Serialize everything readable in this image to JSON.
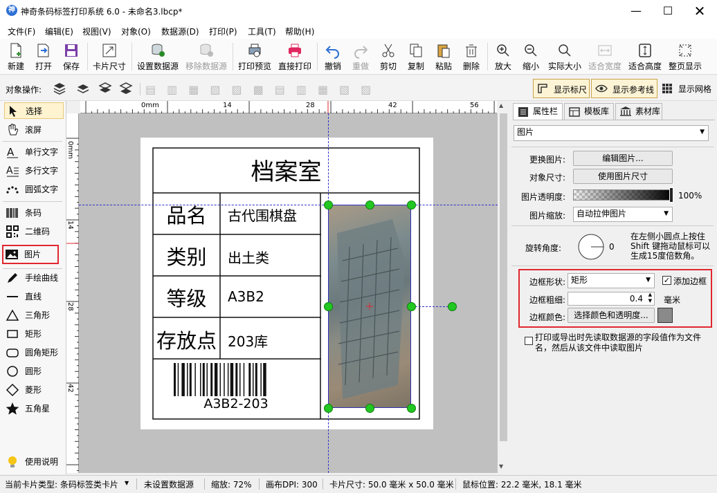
{
  "window": {
    "title": "神奇条码标签打印系统 6.0 - 未命名3.lbcp*"
  },
  "menu": [
    "文件(F)",
    "编辑(E)",
    "视图(V)",
    "对象(O)",
    "数据源(D)",
    "打印(P)",
    "工具(T)",
    "帮助(H)"
  ],
  "toolbar": {
    "new": "新建",
    "open": "打开",
    "save": "保存",
    "card_size": "卡片尺寸",
    "set_datasource": "设置数据源",
    "remove_datasource": "移除数据源",
    "print_preview": "打印预览",
    "direct_print": "直接打印",
    "undo": "撤销",
    "redo": "重做",
    "cut": "剪切",
    "copy": "复制",
    "paste": "粘贴",
    "delete": "删除",
    "zoom_in": "放大",
    "zoom_out": "缩小",
    "actual_size": "实际大小",
    "fit_width": "适合宽度",
    "fit_height": "适合高度",
    "full_page": "整页显示"
  },
  "objbar": {
    "label": "对象操作:",
    "show_ruler": "显示标尺",
    "show_guides": "显示参考线",
    "show_grid": "显示网格"
  },
  "tools": [
    "选择",
    "滚屏",
    "单行文字",
    "多行文字",
    "圆弧文字",
    "条码",
    "二维码",
    "图片",
    "手绘曲线",
    "直线",
    "三角形",
    "矩形",
    "圆角矩形",
    "圆形",
    "菱形",
    "五角星",
    "使用说明"
  ],
  "ruler": {
    "top_ticks": [
      "0mm",
      "14",
      "28",
      "42",
      "56"
    ],
    "left_ticks": [
      "0mm",
      "14",
      "28",
      "42"
    ]
  },
  "label": {
    "title": "档案室",
    "rows": [
      {
        "key": "品名",
        "value": "古代围棋盘"
      },
      {
        "key": "类别",
        "value": "出土类"
      },
      {
        "key": "等级",
        "value": "A3B2"
      },
      {
        "key": "存放点",
        "value": "203库"
      }
    ],
    "barcode_text": "A3B2-203"
  },
  "rightpanel": {
    "tabs": [
      "属性栏",
      "模板库",
      "素材库"
    ],
    "object_type": "图片",
    "change_image_label": "更换图片:",
    "edit_image_btn": "编辑图片...",
    "object_size_label": "对象尺寸:",
    "use_image_size_btn": "使用图片尺寸",
    "opacity_label": "图片透明度:",
    "opacity_value": "100%",
    "scale_label": "图片缩放:",
    "scale_value": "自动拉伸图片",
    "rotate_label": "旋转角度:",
    "rotate_value": "0",
    "rotate_hint": "在左侧小圆点上按住Shift 键拖动鼠标可以生成15度倍数角。",
    "border_shape_label": "边框形状:",
    "border_shape_value": "矩形",
    "add_border_label": "添加边框",
    "add_border_checked": true,
    "border_width_label": "边框粗细:",
    "border_width_value": "0.4",
    "border_width_unit": "毫米",
    "border_color_label": "边框颜色:",
    "border_color_btn": "选择颜色和透明度...",
    "border_color": "#8a8a8a",
    "datasource_option": "打印或导出时先读取数据源的字段值作为文件名，然后从该文件中读取图片"
  },
  "status": {
    "card_type": "当前卡片类型:  条码标签类卡片",
    "datasource": "未设置数据源",
    "zoom": "缩放: 72%",
    "dpi": "画布DPI:  300",
    "card_size": "卡片尺寸:  50.0 毫米 x 50.0 毫米",
    "mouse_pos": "鼠标位置:  22.2 毫米,  18.1 毫米"
  },
  "colors": {
    "highlight": "#e0262e",
    "accent": "#2d6fd6",
    "handle": "#22c722"
  }
}
